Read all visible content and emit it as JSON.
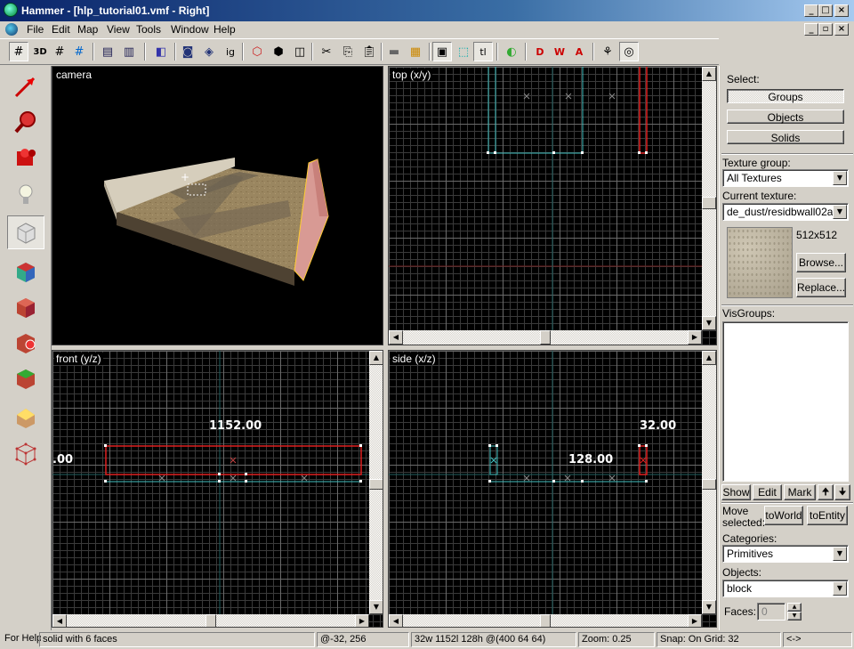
{
  "window": {
    "title": "Hammer - [hlp_tutorial01.vmf - Right]"
  },
  "menu": [
    "File",
    "Edit",
    "Map",
    "View",
    "Tools",
    "Window",
    "Help"
  ],
  "viewports": {
    "camera": "camera",
    "top": "top (x/y)",
    "front": "front (y/z)",
    "side": "side (x/z)"
  },
  "dimensions": {
    "front_width": "1152.00",
    "front_height": ".00",
    "side_width": "128.00",
    "side_height": "32.00"
  },
  "panel": {
    "select_label": "Select:",
    "groups": "Groups",
    "objects": "Objects",
    "solids": "Solids",
    "texture_group_label": "Texture group:",
    "texture_group_value": "All Textures",
    "current_texture_label": "Current texture:",
    "current_texture_value": "de_dust/residbwall02a",
    "texture_size": "512x512",
    "browse": "Browse...",
    "replace": "Replace...",
    "visgroups_label": "VisGroups:",
    "show": "Show",
    "edit": "Edit",
    "mark": "Mark",
    "move_selected_1": "Move",
    "move_selected_2": "selected:",
    "to_world": "toWorld",
    "to_entity": "toEntity",
    "categories_label": "Categories:",
    "categories_value": "Primitives",
    "objects_label": "Objects:",
    "objects_value": "block",
    "faces_label": "Faces:",
    "faces_value": "0"
  },
  "status": {
    "help": "For Help",
    "selection": "solid with 6 faces",
    "coords": "@-32, 256",
    "size": "32w 1152l 128h @(400 64 64)",
    "zoom": "Zoom: 0.25",
    "snap": "Snap: On Grid: 32",
    "extra": "<->"
  },
  "colors": {
    "title_bar": "#0a246a",
    "selection_red": "#e02020",
    "brush_cyan": "#40c0c0",
    "viewport_bg": "#000000"
  }
}
